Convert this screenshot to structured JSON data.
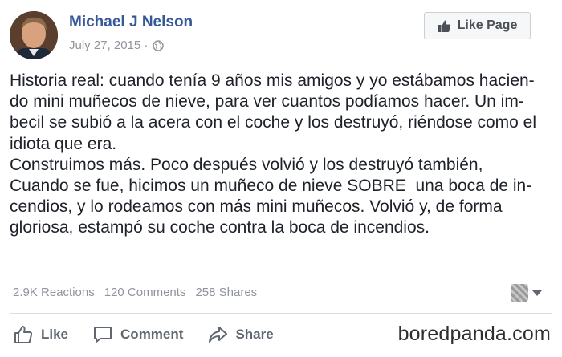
{
  "post": {
    "author": "Michael J Nelson",
    "date": "July 27, 2015 ·",
    "like_page_label": "Like Page",
    "text_lines": [
      "Historia real: cuando tenía 9 años mis amigos y yo estábamos hacien-",
      "do mini muñecos de nieve, para ver cuantos podíamos hacer. Un im-",
      "becil se subió a la acera con el coche y los destruyó, riéndose como el",
      "idiota que era.",
      "Construimos más. Poco después volvió y los destruyó también,",
      "Cuando se fue, hicimos un muñeco de nieve SOBRE  una boca de in-",
      "cendios, y lo rodeamos con más mini muñecos. Volvió y, de forma",
      "gloriosa, estampó su coche contra la boca de incendios."
    ]
  },
  "stats": {
    "reactions": "2.9K Reactions",
    "comments": "120 Comments",
    "shares": "258 Shares"
  },
  "actions": {
    "like": "Like",
    "comment": "Comment",
    "share": "Share"
  },
  "watermark": "boredpanda.com",
  "colors": {
    "link_blue": "#365899",
    "meta_gray": "#90949c",
    "action_gray": "#606770"
  }
}
